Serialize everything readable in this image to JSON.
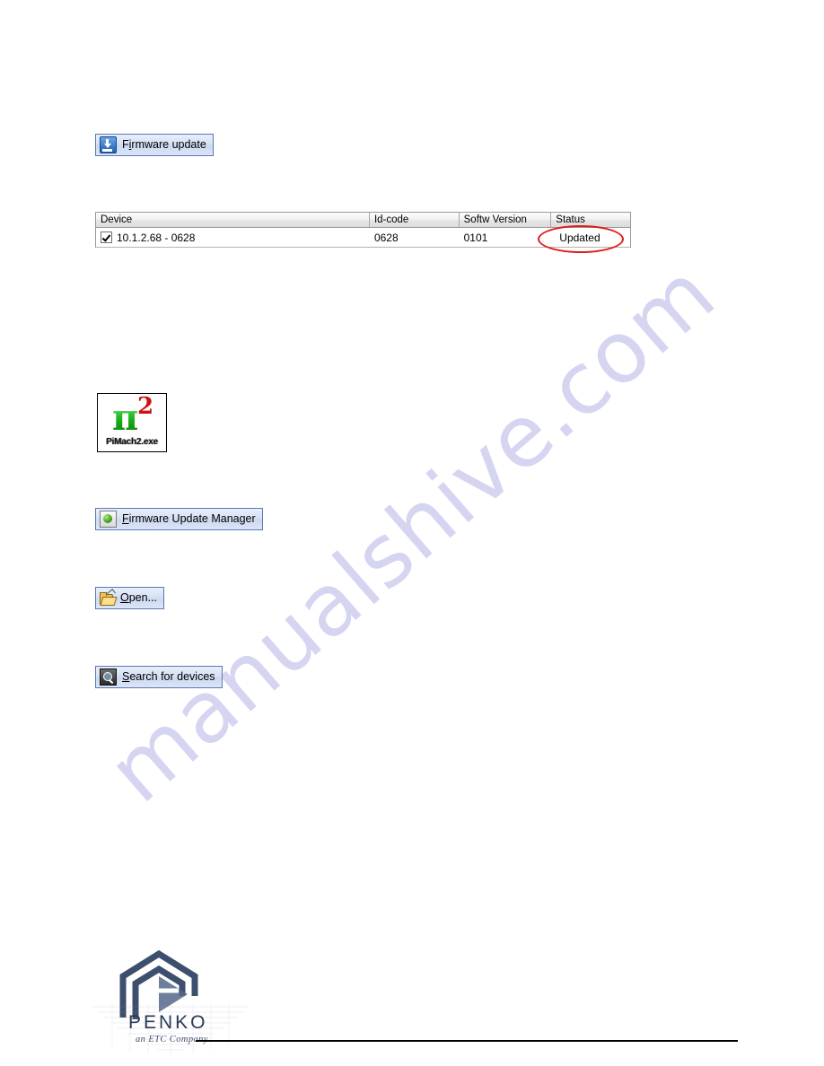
{
  "page": {
    "watermark": "manualshive.com",
    "watermark_color": "#d6d5f1",
    "background": "#ffffff"
  },
  "buttons": {
    "firmware_update": {
      "label_prefix": "F",
      "label_accel": "i",
      "label_suffix": "rmware update",
      "full_label": "Firmware update",
      "icon": "download-icon"
    },
    "firmware_update_manager": {
      "label_accel": "F",
      "label_suffix": "irmware Update Manager",
      "full_label": "Firmware Update Manager",
      "icon": "manager-sphere-icon"
    },
    "open": {
      "label_accel": "O",
      "label_suffix": "pen...",
      "full_label": "Open...",
      "icon": "open-folder-icon"
    },
    "search_for_devices": {
      "label_accel": "S",
      "label_suffix": "earch for devices",
      "full_label": "Search for devices",
      "icon": "magnifier-icon"
    }
  },
  "device_table": {
    "columns": [
      "Device",
      "Id-code",
      "Softw Version",
      "Status"
    ],
    "rows": [
      {
        "checked": true,
        "device": "10.1.2.68 - 0628",
        "id_code": "0628",
        "softw_version": "0101",
        "status": "Updated"
      }
    ],
    "annotation": {
      "shape": "ellipse",
      "color": "#e01b1b",
      "targets": "Updated"
    }
  },
  "desktop_icon": {
    "filename": "PiMach2.exe",
    "symbol": "π",
    "superscript": "2",
    "symbol_color": "#18b018",
    "superscript_color": "#cc1111"
  },
  "footer": {
    "brand": "PENKO",
    "tagline": "an ETC Company"
  }
}
